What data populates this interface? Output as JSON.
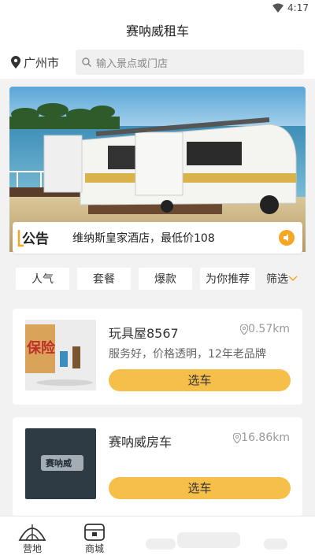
{
  "status": {
    "time": "4:17"
  },
  "header": {
    "title": "赛呐威租车"
  },
  "location": {
    "city": "广州市"
  },
  "search": {
    "placeholder": "输入景点或门店"
  },
  "notice": {
    "logo_text": "公告",
    "text": "维纳斯皇家酒店，最低价108"
  },
  "tabs": [
    {
      "label": "人气"
    },
    {
      "label": "套餐"
    },
    {
      "label": "爆款"
    },
    {
      "label": "为你推荐"
    }
  ],
  "filter": {
    "label": "筛选"
  },
  "cards": [
    {
      "name": "玩具屋8567",
      "distance": "0.57km",
      "desc": "服务好，价格透明，12年老品牌",
      "button": "选车",
      "thumb_text": "保险"
    },
    {
      "name": "赛呐威房车",
      "distance": "16.86km",
      "desc": "",
      "button": "选车",
      "thumb_text": "赛呐威"
    }
  ],
  "nav": [
    {
      "label": "营地"
    },
    {
      "label": "商城"
    }
  ],
  "colors": {
    "accent": "#f6bf4a",
    "notice_icon": "#f5a623"
  }
}
